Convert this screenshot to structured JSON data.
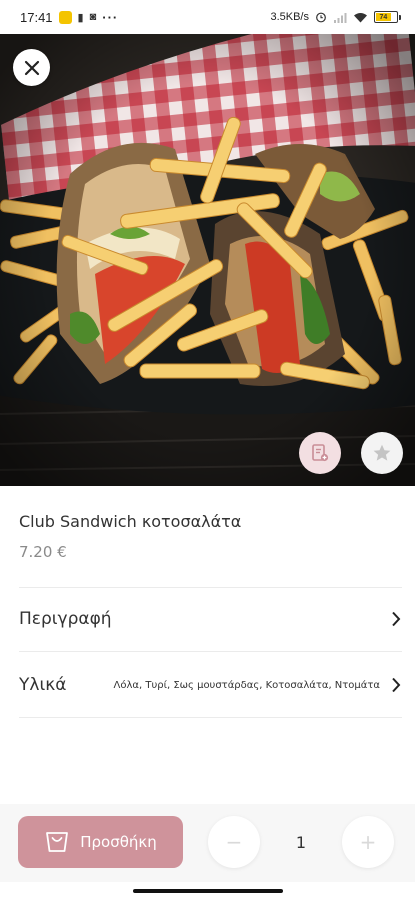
{
  "status_bar": {
    "time": "17:41",
    "network_speed": "3.5KB/s",
    "battery_level": "74",
    "more_indicator": "···"
  },
  "product": {
    "name": "Club Sandwich κοτοσαλάτα",
    "price": "7.20 €"
  },
  "details": [
    {
      "label": "Περιγραφή",
      "value": ""
    },
    {
      "label": "Υλικά",
      "value": "Λόλα, Τυρί, Σως μουστάρδας, Κοτοσαλάτα, Ντομάτα"
    }
  ],
  "actions": {
    "add_label": "Προσθήκη",
    "minus_symbol": "−",
    "plus_symbol": "+",
    "quantity": "1"
  },
  "icons": {
    "close": "close-icon",
    "note": "note-add-icon",
    "favorite": "star-icon",
    "chevron": "chevron-right-icon",
    "cart": "shopping-bag-icon"
  },
  "colors": {
    "accent": "#cf939b",
    "accent_light": "#f3dfe2",
    "price_text": "#8a8a8a",
    "battery": "#f4c400"
  }
}
